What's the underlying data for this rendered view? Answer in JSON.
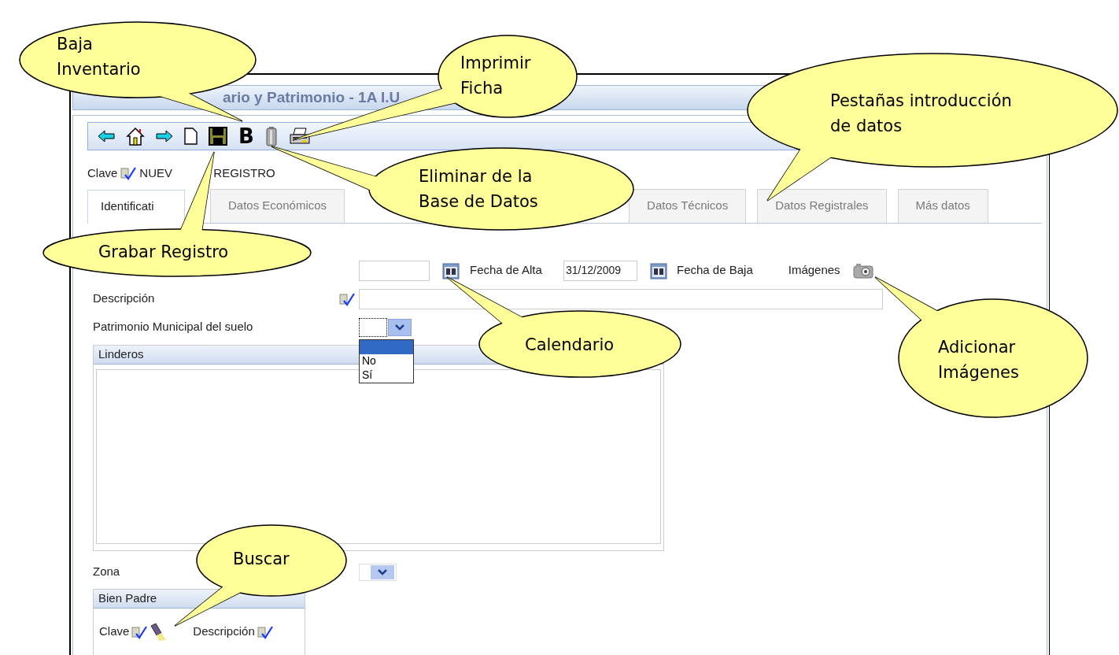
{
  "window": {
    "title": "ario y Patrimonio - 1A I.U"
  },
  "toolbar": [
    {
      "kind": "back"
    },
    {
      "kind": "home"
    },
    {
      "kind": "forward"
    },
    {
      "kind": "new"
    },
    {
      "kind": "save"
    },
    {
      "kind": "glyph",
      "label": "B"
    },
    {
      "kind": "trash"
    },
    {
      "kind": "print"
    }
  ],
  "record": {
    "label": "Clave",
    "value_parts": [
      "NUEV",
      "REGISTRO"
    ]
  },
  "tabs": [
    {
      "label": "Identificati",
      "selected": true
    },
    {
      "label": "Datos Económicos",
      "selected": false
    },
    {
      "label": "Datos Técnicos",
      "selected": false
    },
    {
      "label": "Datos Registrales",
      "selected": false
    },
    {
      "label": "Más datos",
      "selected": false
    }
  ],
  "dates": {
    "alta_label": "Fecha de Alta",
    "alta_value": "31/12/2009",
    "baja_label": "Fecha de Baja",
    "images_label": "Imágenes"
  },
  "description": {
    "label": "Descripción"
  },
  "patrimonio": {
    "label": "Patrimonio Municipal del suelo",
    "options": [
      {
        "selected": true
      },
      {
        "label": "No",
        "selected": false
      },
      {
        "label": "Sí",
        "selected": false
      }
    ]
  },
  "linderos": {
    "title": "Linderos"
  },
  "zona": {
    "label": "Zona"
  },
  "bien_padre": {
    "title": "Bien Padre",
    "clave_label": "Clave",
    "descripcion_label": "Descripción"
  },
  "callouts": [
    {
      "lines": [
        "Baja",
        "Inventario"
      ]
    },
    {
      "lines": [
        "Imprimir",
        "Ficha"
      ]
    },
    {
      "lines": [
        "Pestañas introducción",
        "de datos"
      ]
    },
    {
      "lines": [
        "Eliminar de la",
        "Base de Datos"
      ]
    },
    {
      "lines": [
        "Grabar Registro"
      ]
    },
    {
      "lines": [
        "Calendario"
      ]
    },
    {
      "lines": [
        "Adicionar",
        "Imágenes"
      ]
    },
    {
      "lines": [
        "Buscar"
      ]
    }
  ]
}
